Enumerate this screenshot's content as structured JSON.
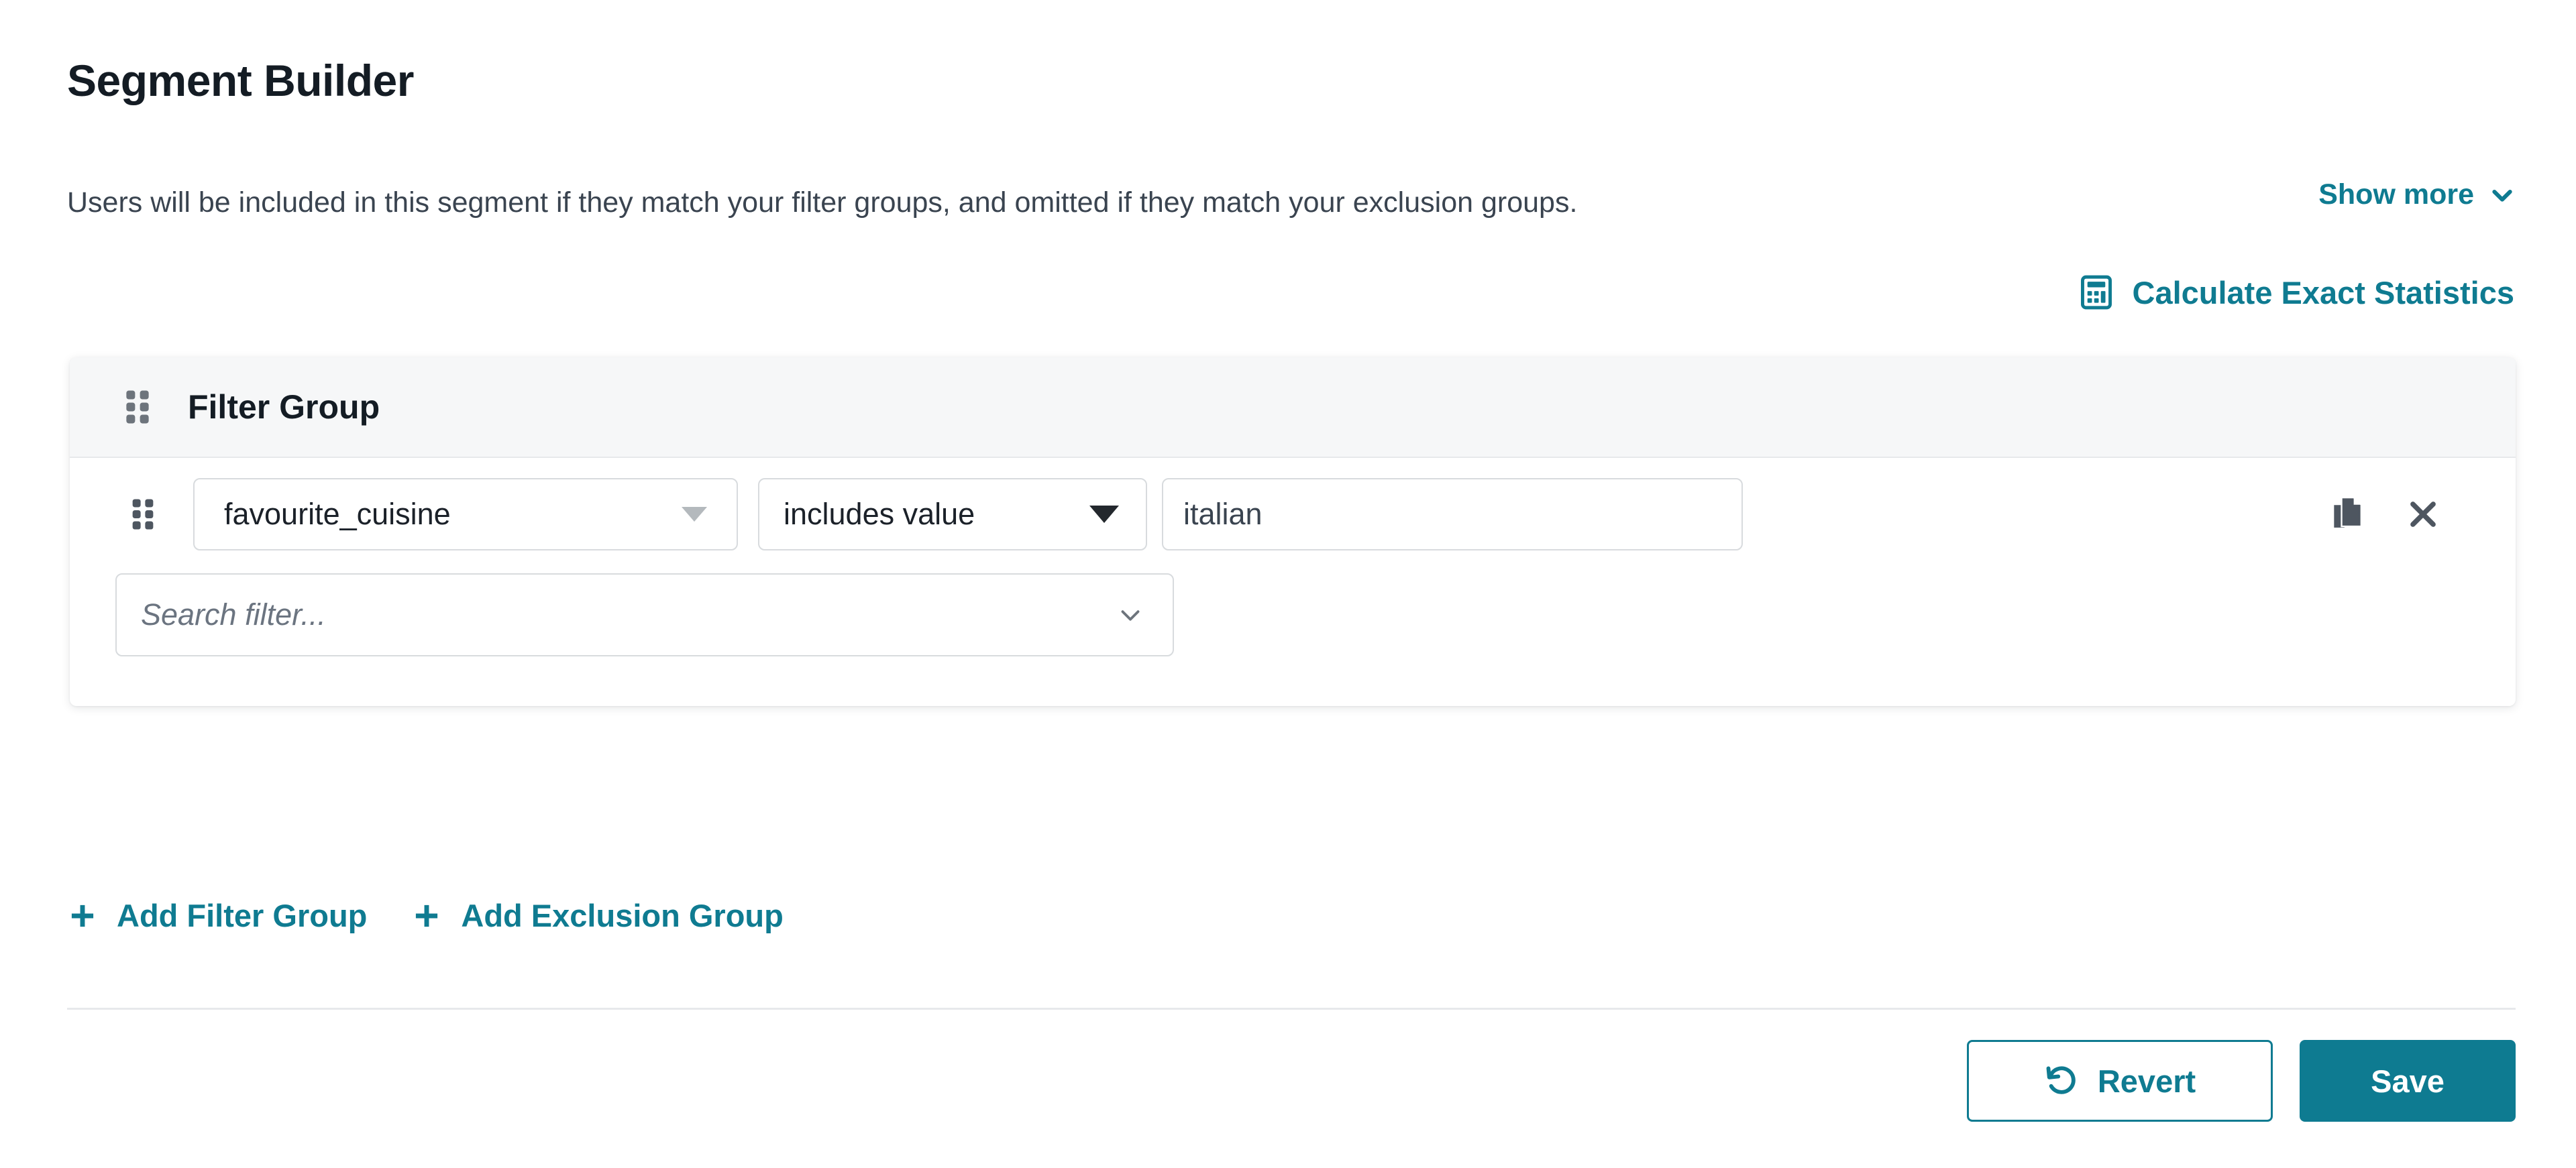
{
  "header": {
    "title": "Segment Builder",
    "description": "Users will be included in this segment if they match your filter groups, and omitted if they match your exclusion groups.",
    "show_more_label": "Show more",
    "show_more_icon": "chevron-down-icon"
  },
  "statistics": {
    "label": "Calculate Exact Statistics",
    "icon": "calculator-icon"
  },
  "filter_group": {
    "title": "Filter Group",
    "drag_handle_icon": "drag-handle-icon",
    "rows": [
      {
        "drag_handle_icon": "drag-handle-icon",
        "field": "favourite_cuisine",
        "field_icon": "triangle-down-icon",
        "operator": "includes value",
        "operator_icon": "triangle-down-icon",
        "value": "italian",
        "value_placeholder": "",
        "duplicate_icon": "duplicate-icon",
        "remove_icon": "close-icon"
      }
    ],
    "search_filter": {
      "placeholder": "Search filter...",
      "value": "",
      "icon": "chevron-down-icon"
    }
  },
  "actions": {
    "add_filter_group": "Add Filter Group",
    "add_filter_group_icon": "plus-icon",
    "add_exclusion_group": "Add Exclusion Group",
    "add_exclusion_group_icon": "plus-icon"
  },
  "footer": {
    "revert_label": "Revert",
    "revert_icon": "undo-icon",
    "save_label": "Save"
  },
  "colors": {
    "accent_teal": "#0f7b91",
    "save_button_bg": "#0e7b91",
    "text_primary": "#141c24",
    "text_secondary": "#3a4450",
    "border": "#d8dbde",
    "group_header_bg": "#f6f7f8"
  }
}
